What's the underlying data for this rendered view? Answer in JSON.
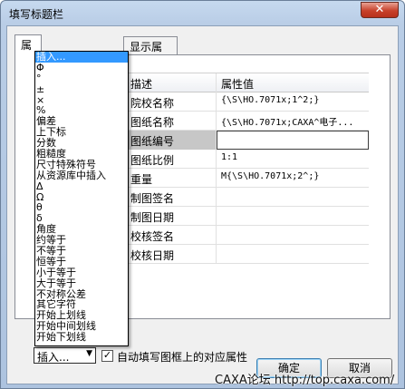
{
  "window": {
    "title": "填写标题栏",
    "close_glyph": "✕"
  },
  "tabs": [
    {
      "label": "属",
      "active": true
    },
    {
      "label": "显示属性",
      "active": false
    }
  ],
  "grid": {
    "header": {
      "name": "描述",
      "value": "属性值"
    },
    "rows": [
      {
        "name": "院校名称",
        "value": "{\\S\\HO.7071x;1^2;}"
      },
      {
        "name": "图纸名称",
        "value": "{\\S\\HO.7071x;CAXA^电子..."
      },
      {
        "name": "图纸编号",
        "value": ""
      },
      {
        "name": "图纸比例",
        "value": "1:1"
      },
      {
        "name": "重量",
        "value": "M{\\S\\HO.7071x;2^;}"
      },
      {
        "name": "制图签名",
        "value": ""
      },
      {
        "name": "制图日期",
        "value": ""
      },
      {
        "name": "校核签名",
        "value": ""
      },
      {
        "name": "校核日期",
        "value": ""
      }
    ]
  },
  "popup_menu": {
    "items": [
      "插入...",
      "Φ",
      "°",
      "±",
      "×",
      "%",
      "偏差",
      "上下标",
      "分数",
      "粗糙度",
      "尺寸特殊符号",
      "从资源库中插入",
      "Δ",
      "Ω",
      "θ",
      "δ",
      "角度",
      "约等于",
      "不等于",
      "恒等于",
      "小于等于",
      "大于等于",
      "不对称公差",
      "其它字符",
      "开始上划线",
      "开始中间划线",
      "开始下划线"
    ]
  },
  "bottom": {
    "insert_button": "插入...",
    "insert_arrow": "▼",
    "auto_fill_label": "自动填写图框上的对应属性",
    "auto_fill_checked": true,
    "ok_button": "确定",
    "cancel_button": "取消"
  },
  "watermark": "CAXA论坛 http://top.caxa.com/"
}
